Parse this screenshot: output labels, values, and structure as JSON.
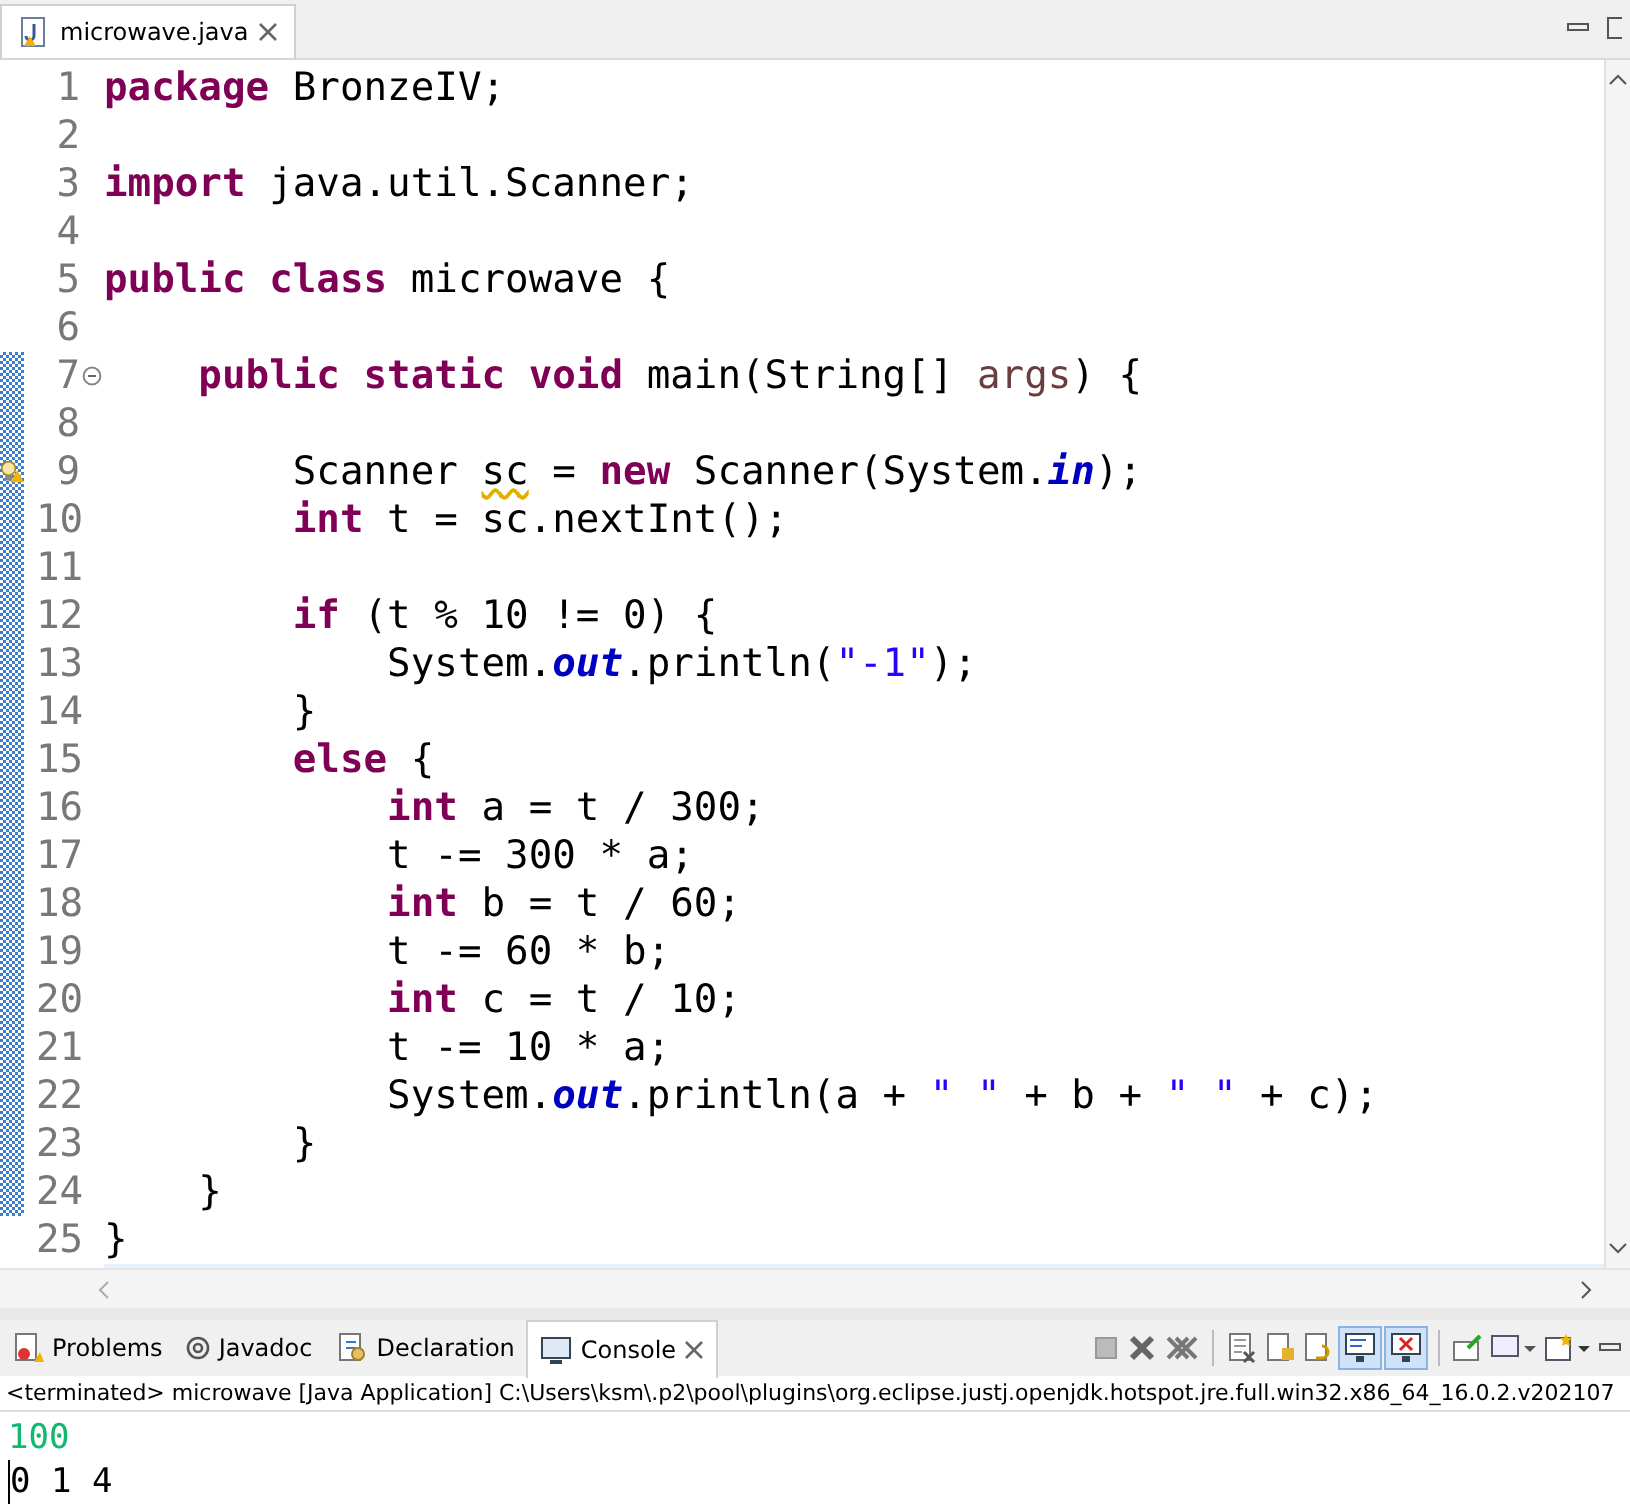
{
  "editor_tab": {
    "title": "microwave.java",
    "selected": true
  },
  "code_lines": [
    {
      "number": "1",
      "range": false,
      "tokens": [
        {
          "text": "package",
          "kind": "kw"
        },
        {
          "text": " BronzeIV;",
          "kind": "plain"
        }
      ]
    },
    {
      "number": "2",
      "range": false
    },
    {
      "number": "3",
      "range": false,
      "tokens": [
        {
          "text": "import",
          "kind": "kw"
        },
        {
          "text": " java.util.Scanner;",
          "kind": "plain"
        }
      ]
    },
    {
      "number": "4",
      "range": false
    },
    {
      "number": "5",
      "range": false,
      "tokens": [
        {
          "text": "public",
          "kind": "kw"
        },
        {
          "text": " class",
          "kind": "kw"
        },
        {
          "text": " microwave {",
          "kind": "plain"
        }
      ]
    },
    {
      "number": "6",
      "range": false
    },
    {
      "number": "7",
      "expanded": true,
      "range": true,
      "tokens": [
        {
          "text": "    public",
          "kind": "kw"
        },
        {
          "text": " static",
          "kind": "kw"
        },
        {
          "text": " void",
          "kind": "kw"
        },
        {
          "text": " main(String[] ",
          "kind": "plain"
        },
        {
          "text": "args",
          "kind": "param"
        },
        {
          "text": ") {",
          "kind": "plain"
        }
      ]
    },
    {
      "number": "8",
      "range": true
    },
    {
      "number": "9",
      "warning": true,
      "range": true,
      "tokens": [
        {
          "text": "        Scanner ",
          "kind": "plain"
        },
        {
          "text": "sc",
          "kind": "warn"
        },
        {
          "text": " = ",
          "kind": "plain"
        },
        {
          "text": "new",
          "kind": "kw"
        },
        {
          "text": " Scanner(System.",
          "kind": "plain"
        },
        {
          "text": "in",
          "kind": "field"
        },
        {
          "text": ");",
          "kind": "plain"
        }
      ]
    },
    {
      "number": "10",
      "range": true,
      "tokens": [
        {
          "text": "        int",
          "kind": "kw"
        },
        {
          "text": " t = sc.nextInt();",
          "kind": "plain"
        }
      ]
    },
    {
      "number": "11",
      "range": true
    },
    {
      "number": "12",
      "range": true,
      "tokens": [
        {
          "text": "        if",
          "kind": "kw"
        },
        {
          "text": " (t % 10 != 0) {",
          "kind": "plain"
        }
      ]
    },
    {
      "number": "13",
      "range": true,
      "tokens": [
        {
          "text": "            System.",
          "kind": "plain"
        },
        {
          "text": "out",
          "kind": "field"
        },
        {
          "text": ".println(",
          "kind": "plain"
        },
        {
          "text": "\"-1\"",
          "kind": "str"
        },
        {
          "text": ");",
          "kind": "plain"
        }
      ]
    },
    {
      "number": "14",
      "range": true,
      "tokens": [
        {
          "text": "        }",
          "kind": "plain"
        }
      ]
    },
    {
      "number": "15",
      "range": true,
      "tokens": [
        {
          "text": "        else",
          "kind": "kw"
        },
        {
          "text": " {",
          "kind": "plain"
        }
      ]
    },
    {
      "number": "16",
      "range": true,
      "tokens": [
        {
          "text": "            int",
          "kind": "kw"
        },
        {
          "text": " a = t / 300;",
          "kind": "plain"
        }
      ]
    },
    {
      "number": "17",
      "range": true,
      "tokens": [
        {
          "text": "            t -= 300 * a;",
          "kind": "plain"
        }
      ]
    },
    {
      "number": "18",
      "range": true,
      "tokens": [
        {
          "text": "            int",
          "kind": "kw"
        },
        {
          "text": " b = t / 60;",
          "kind": "plain"
        }
      ]
    },
    {
      "number": "19",
      "range": true,
      "tokens": [
        {
          "text": "            t -= 60 * b;",
          "kind": "plain"
        }
      ]
    },
    {
      "number": "20",
      "range": true,
      "tokens": [
        {
          "text": "            int",
          "kind": "kw"
        },
        {
          "text": " c = t / 10;",
          "kind": "plain"
        }
      ]
    },
    {
      "number": "21",
      "range": true,
      "tokens": [
        {
          "text": "            t -= 10 * a;",
          "kind": "plain"
        }
      ]
    },
    {
      "number": "22",
      "range": true,
      "tokens": [
        {
          "text": "            System.",
          "kind": "plain"
        },
        {
          "text": "out",
          "kind": "field"
        },
        {
          "text": ".println(a + ",
          "kind": "plain"
        },
        {
          "text": "\" \"",
          "kind": "str"
        },
        {
          "text": " + b + ",
          "kind": "plain"
        },
        {
          "text": "\" \"",
          "kind": "str"
        },
        {
          "text": " + c);",
          "kind": "plain"
        }
      ]
    },
    {
      "number": "23",
      "range": true,
      "tokens": [
        {
          "text": "        }",
          "kind": "plain"
        }
      ]
    },
    {
      "number": "24",
      "range": true,
      "tokens": [
        {
          "text": "    }",
          "kind": "plain"
        }
      ]
    },
    {
      "number": "25",
      "range": false,
      "tokens": [
        {
          "text": "}",
          "kind": "plain"
        }
      ]
    }
  ],
  "bottom_tabs": [
    {
      "label": "Problems",
      "selected": false
    },
    {
      "label": "Javadoc",
      "selected": false
    },
    {
      "label": "Declaration",
      "selected": false
    },
    {
      "label": "Console",
      "selected": true
    }
  ],
  "console": {
    "status": "<terminated> microwave [Java Application] C:\\Users\\ksm\\.p2\\pool\\plugins\\org.eclipse.justj.openjdk.hotspot.jre.full.win32.x86_64_16.0.2.v202107",
    "output": [
      {
        "text": "100",
        "kind": "input"
      },
      {
        "text": "0 1 4",
        "kind": "output"
      }
    ]
  }
}
